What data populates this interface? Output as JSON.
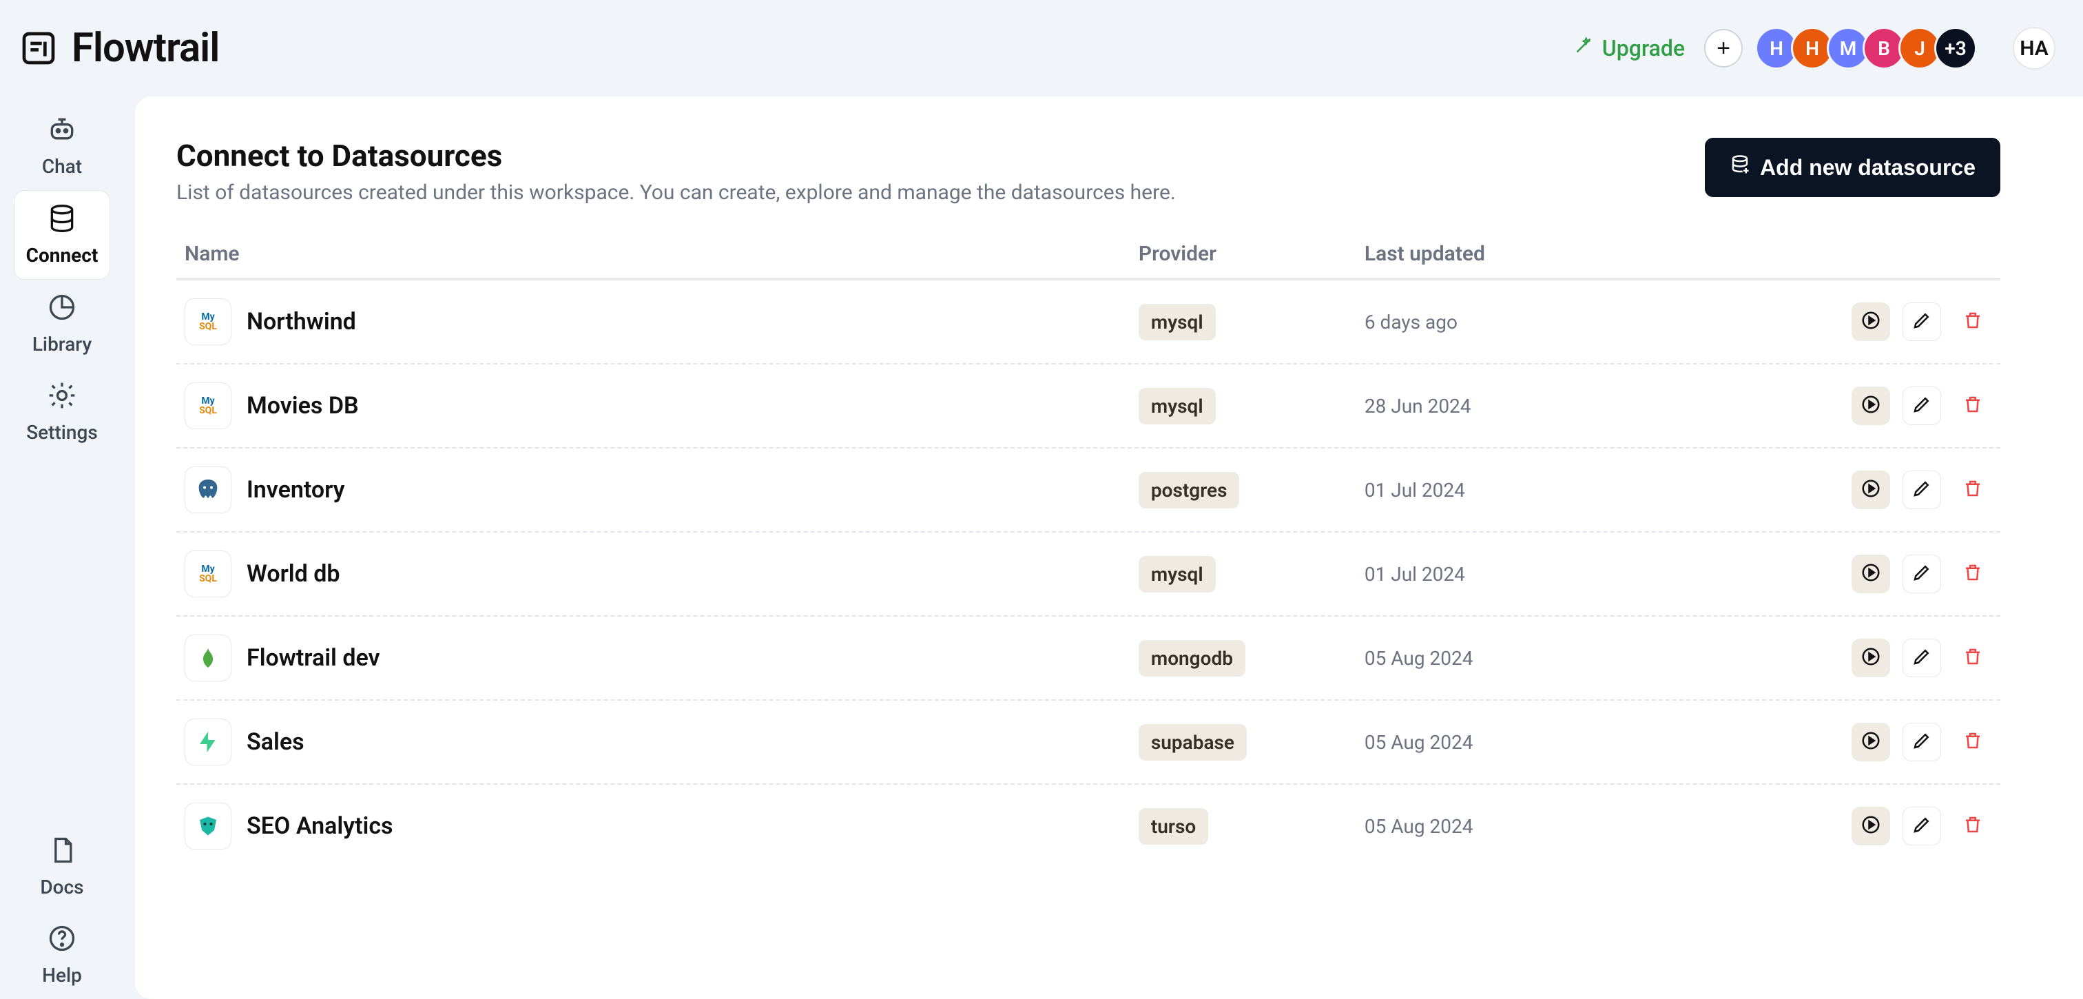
{
  "brand": {
    "name": "Flowtrail"
  },
  "topbar": {
    "upgrade_label": "Upgrade",
    "add_label": "+",
    "avatars": [
      {
        "letter": "H",
        "color": "#6c7cff"
      },
      {
        "letter": "H",
        "color": "#e8590c"
      },
      {
        "letter": "M",
        "color": "#6c7cff"
      },
      {
        "letter": "B",
        "color": "#e0316f"
      },
      {
        "letter": "J",
        "color": "#e8590c"
      }
    ],
    "avatar_more": "+3",
    "me": "HA"
  },
  "sidebar": {
    "items": [
      {
        "key": "chat",
        "label": "Chat",
        "icon": "robot-icon"
      },
      {
        "key": "connect",
        "label": "Connect",
        "icon": "database-icon",
        "active": true
      },
      {
        "key": "library",
        "label": "Library",
        "icon": "pie-icon"
      },
      {
        "key": "settings",
        "label": "Settings",
        "icon": "gear-icon"
      }
    ],
    "footer": [
      {
        "key": "docs",
        "label": "Docs",
        "icon": "doc-icon"
      },
      {
        "key": "help",
        "label": "Help",
        "icon": "help-icon"
      }
    ]
  },
  "page": {
    "title": "Connect to Datasources",
    "subtitle": "List of datasources created under this workspace. You can create, explore and manage the datasources here.",
    "primary_label": "Add new datasource"
  },
  "table": {
    "columns": {
      "name": "Name",
      "provider": "Provider",
      "updated": "Last updated"
    },
    "rows": [
      {
        "name": "Northwind",
        "provider": "mysql",
        "updated": "6 days ago",
        "icon": "mysql"
      },
      {
        "name": "Movies DB",
        "provider": "mysql",
        "updated": "28 Jun 2024",
        "icon": "mysql"
      },
      {
        "name": "Inventory",
        "provider": "postgres",
        "updated": "01 Jul 2024",
        "icon": "postgres"
      },
      {
        "name": "World db",
        "provider": "mysql",
        "updated": "01 Jul 2024",
        "icon": "mysql"
      },
      {
        "name": "Flowtrail dev",
        "provider": "mongodb",
        "updated": "05 Aug 2024",
        "icon": "mongodb"
      },
      {
        "name": "Sales",
        "provider": "supabase",
        "updated": "05 Aug 2024",
        "icon": "supabase"
      },
      {
        "name": "SEO Analytics",
        "provider": "turso",
        "updated": "05 Aug 2024",
        "icon": "turso"
      }
    ]
  }
}
